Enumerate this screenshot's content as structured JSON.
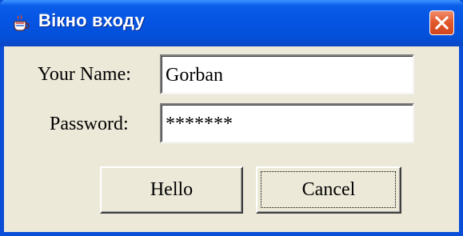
{
  "window": {
    "title": "Вікно входу",
    "icon": "java-cup-icon",
    "close_icon": "close-icon"
  },
  "form": {
    "name_label": "Your Name:",
    "name_value": "Gorban",
    "password_label": "Password:",
    "password_value": "*******"
  },
  "buttons": {
    "hello_label": "Hello",
    "cancel_label": "Cancel"
  },
  "colors": {
    "titlebar": "#0554e3",
    "close_button": "#e35a2e",
    "window_background": "#ece9d8"
  }
}
